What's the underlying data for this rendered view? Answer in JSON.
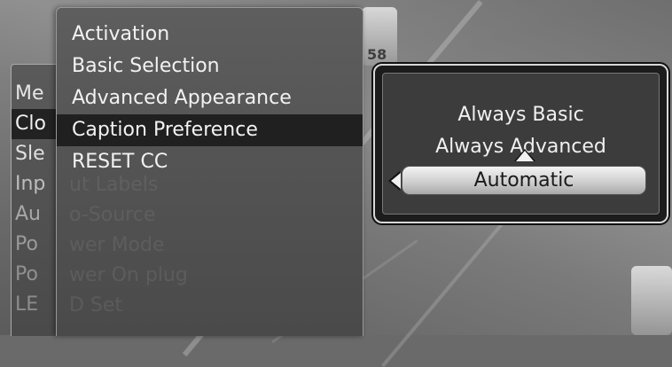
{
  "parent_menu": {
    "items": [
      {
        "label": "Me",
        "highlighted": false
      },
      {
        "label": "Clo",
        "highlighted": true
      },
      {
        "label": "Sle",
        "highlighted": false
      },
      {
        "label": "Inp",
        "highlighted": false
      },
      {
        "label": "Au",
        "highlighted": false
      },
      {
        "label": "Po",
        "highlighted": false
      },
      {
        "label": "Po",
        "highlighted": false
      },
      {
        "label": "LE",
        "highlighted": false
      }
    ],
    "ghost_fragments": [
      "ut Labels",
      "o-Source",
      "wer Mode",
      "wer On plug",
      "D Set"
    ]
  },
  "submenu": {
    "items": [
      {
        "label": "Activation"
      },
      {
        "label": "Basic Selection"
      },
      {
        "label": "Advanced Appearance"
      },
      {
        "label": "Caption Preference"
      },
      {
        "label": "RESET CC"
      }
    ],
    "selected_index": 3
  },
  "popup": {
    "options": [
      "Always Basic",
      "Always Advanced",
      "Automatic"
    ],
    "selected": "Automatic"
  },
  "background": {
    "jersey_number": "58"
  }
}
